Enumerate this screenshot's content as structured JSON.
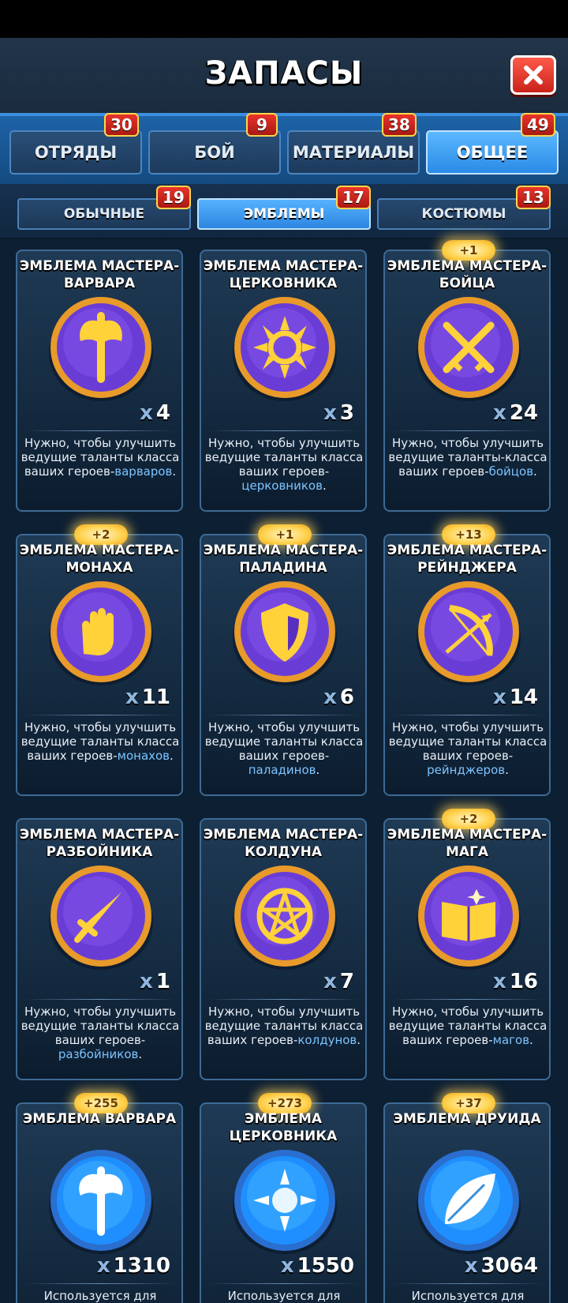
{
  "header": {
    "title": "ЗАПАСЫ"
  },
  "tabs": [
    {
      "label": "ОТРЯДЫ",
      "badge": "30"
    },
    {
      "label": "БОЙ",
      "badge": "9"
    },
    {
      "label": "МАТЕРИАЛЫ",
      "badge": "38"
    },
    {
      "label": "ОБЩЕЕ",
      "badge": "49"
    }
  ],
  "subtabs": [
    {
      "label": "ОБЫЧНЫЕ",
      "badge": "19"
    },
    {
      "label": "ЭМБЛЕМЫ",
      "badge": "17"
    },
    {
      "label": "КОСТЮМЫ",
      "badge": "13"
    }
  ],
  "colors": {
    "accent_blue": "#2a8ae6",
    "badge_red": "#e8342a",
    "emblem_purple": "#6a3cd6",
    "emblem_gold": "#ffd23a",
    "class_highlight": "#7cc4ff"
  },
  "cards": [
    {
      "title": "ЭМБЛЕМА МАСТЕРА-\nВАРВАРА",
      "icon": "axe-icon",
      "count_prefix": "x",
      "count": "4",
      "desc_pre": "Нужно, чтобы улучшить ведущие таланты класса ваших героев-",
      "desc_hl": "варваров",
      "desc_post": ".",
      "plus": ""
    },
    {
      "title": "ЭМБЛЕМА МАСТЕРА-\nЦЕРКОВНИКА",
      "icon": "sun-icon",
      "count_prefix": "x",
      "count": "3",
      "desc_pre": "Нужно, чтобы улучшить ведущие таланты класса ваших героев-",
      "desc_hl": "церковников",
      "desc_post": ".",
      "plus": ""
    },
    {
      "title": "ЭМБЛЕМА МАСТЕРА-\nБОЙЦА",
      "icon": "crossed-swords-icon",
      "count_prefix": "x",
      "count": "24",
      "desc_pre": "Нужно, чтобы улучшить ведущие таланты-класса ваших героев-",
      "desc_hl": "бойцов",
      "desc_post": ".",
      "plus": "+1"
    },
    {
      "title": "ЭМБЛЕМА МАСТЕРА-\nМОНАХА",
      "icon": "palm-icon",
      "count_prefix": "x",
      "count": "11",
      "desc_pre": "Нужно, чтобы улучшить ведущие таланты класса ваших героев-",
      "desc_hl": "монахов",
      "desc_post": ".",
      "plus": "+2"
    },
    {
      "title": "ЭМБЛЕМА МАСТЕРА-\nПАЛАДИНА",
      "icon": "shield-icon",
      "count_prefix": "x",
      "count": "6",
      "desc_pre": "Нужно, чтобы улучшить ведущие таланты класса ваших героев-",
      "desc_hl": "паладинов",
      "desc_post": ".",
      "plus": "+1"
    },
    {
      "title": "ЭМБЛЕМА МАСТЕРА-\nРЕЙНДЖЕРА",
      "icon": "bow-icon",
      "count_prefix": "x",
      "count": "14",
      "desc_pre": "Нужно, чтобы улучшить ведущие таланты класса ваших героев-",
      "desc_hl": "рейнджеров",
      "desc_post": ".",
      "plus": "+13"
    },
    {
      "title": "ЭМБЛЕМА МАСТЕРА-\nРАЗБОЙНИКА",
      "icon": "dagger-icon",
      "count_prefix": "x",
      "count": "1",
      "desc_pre": "Нужно, чтобы улучшить ведущие таланты класса ваших героев-",
      "desc_hl": "разбойников",
      "desc_post": ".",
      "plus": ""
    },
    {
      "title": "ЭМБЛЕМА МАСТЕРА-\nКОЛДУНА",
      "icon": "pentagram-icon",
      "count_prefix": "x",
      "count": "7",
      "desc_pre": "Нужно, чтобы улучшить ведущие таланты класса ваших героев-",
      "desc_hl": "колдунов",
      "desc_post": ".",
      "plus": ""
    },
    {
      "title": "ЭМБЛЕМА МАСТЕРА-\nМАГА",
      "icon": "book-icon",
      "count_prefix": "x",
      "count": "16",
      "desc_pre": "Нужно, чтобы улучшить ведущие таланты класса ваших героев-",
      "desc_hl": "магов",
      "desc_post": ".",
      "plus": "+2"
    },
    {
      "title": "ЭМБЛЕМА ВАРВАРА",
      "icon": "axe-blue-icon",
      "count_prefix": "x",
      "count": "1310",
      "desc_pre": "Используется для",
      "desc_hl": "",
      "desc_post": "",
      "plus": "+255"
    },
    {
      "title": "ЭМБЛЕМА\nЦЕРКОВНИКА",
      "icon": "sun-blue-icon",
      "count_prefix": "x",
      "count": "1550",
      "desc_pre": "Используется для",
      "desc_hl": "",
      "desc_post": "",
      "plus": "+273"
    },
    {
      "title": "ЭМБЛЕМА ДРУИДА",
      "icon": "leaf-icon",
      "count_prefix": "x",
      "count": "3064",
      "desc_pre": "Используется для",
      "desc_hl": "",
      "desc_post": "",
      "plus": "+37"
    }
  ]
}
